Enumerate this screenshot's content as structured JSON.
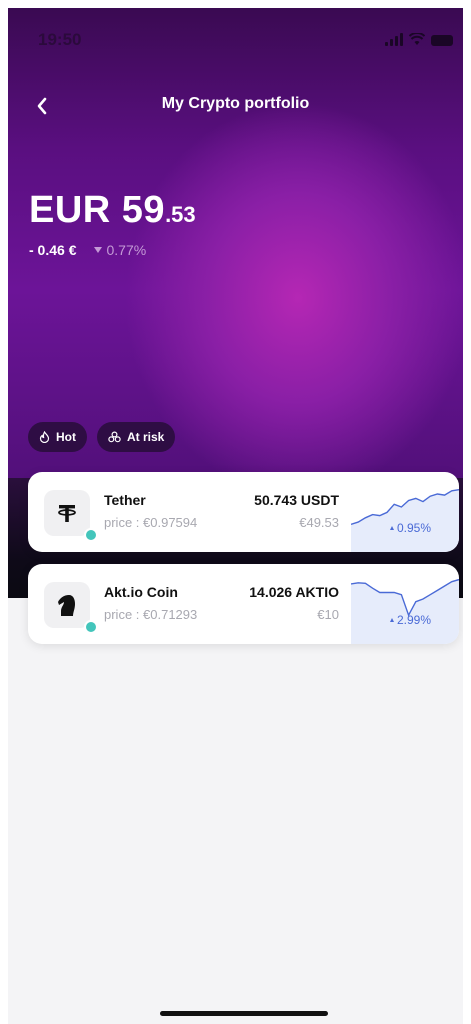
{
  "status": {
    "time": "19:50"
  },
  "header": {
    "title": "My Crypto portfolio"
  },
  "portfolio": {
    "balance_main": "EUR 59",
    "balance_decimal": ".53",
    "change_abs": "- 0.46 €",
    "change_pct": "0.77%"
  },
  "filters": [
    {
      "label": "Hot",
      "icon": "flame-icon"
    },
    {
      "label": "At risk",
      "icon": "risk-cluster-icon"
    }
  ],
  "assets": [
    {
      "name": "Tether",
      "price": "price : €0.97594",
      "quantity": "50.743 USDT",
      "value": "€49.53",
      "change": "0.95%",
      "icon": "tether-icon",
      "sparkline": [
        0.18,
        0.22,
        0.3,
        0.36,
        0.34,
        0.4,
        0.55,
        0.5,
        0.62,
        0.66,
        0.6,
        0.7,
        0.74,
        0.72,
        0.8,
        0.82
      ]
    },
    {
      "name": "Akt.io Coin",
      "price": "price : €0.71293",
      "quantity": "14.026 AKTIO",
      "value": "€10",
      "change": "2.99%",
      "icon": "knight-icon",
      "sparkline": [
        0.78,
        0.8,
        0.79,
        0.7,
        0.62,
        0.62,
        0.62,
        0.58,
        0.2,
        0.45,
        0.5,
        0.58,
        0.66,
        0.74,
        0.82,
        0.86
      ]
    }
  ],
  "colors": {
    "accent": "#b527b4",
    "positive": "#4a6ad6",
    "online_dot": "#43c5bb"
  }
}
